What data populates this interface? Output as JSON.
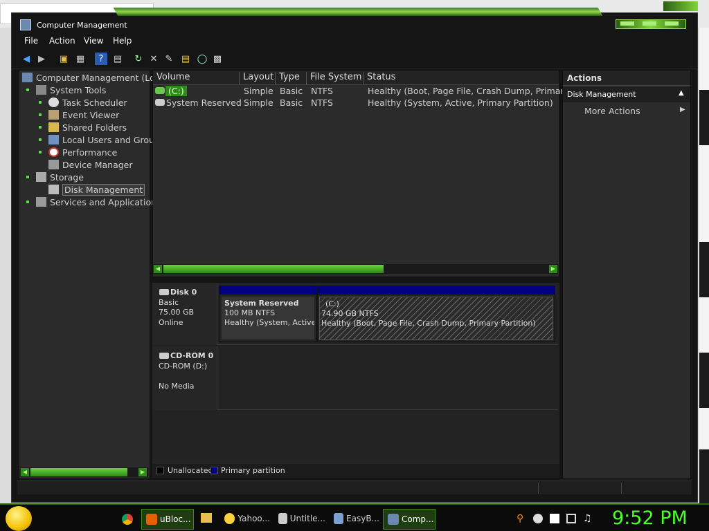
{
  "window": {
    "title": "Computer Management"
  },
  "menu": [
    "File",
    "Action",
    "View",
    "Help"
  ],
  "tree": {
    "root": "Computer Management (Loc",
    "items": [
      {
        "label": "System Tools"
      },
      {
        "label": "Task Scheduler"
      },
      {
        "label": "Event Viewer"
      },
      {
        "label": "Shared Folders"
      },
      {
        "label": "Local Users and Grou"
      },
      {
        "label": "Performance"
      },
      {
        "label": "Device Manager"
      },
      {
        "label": "Storage"
      },
      {
        "label": "Disk Management"
      },
      {
        "label": "Services and Application"
      }
    ]
  },
  "volumes": {
    "columns": [
      "Volume",
      "Layout",
      "Type",
      "File System",
      "Status"
    ],
    "rows": [
      {
        "volume": "(C:)",
        "layout": "Simple",
        "type": "Basic",
        "fs": "NTFS",
        "status": "Healthy (Boot, Page File, Crash Dump, Primary"
      },
      {
        "volume": "System Reserved",
        "layout": "Simple",
        "type": "Basic",
        "fs": "NTFS",
        "status": "Healthy (System, Active, Primary Partition)"
      }
    ]
  },
  "disks": [
    {
      "name": "Disk 0",
      "type": "Basic",
      "size": "75.00 GB",
      "state": "Online",
      "partitions": [
        {
          "name": "System Reserved",
          "size": "100 MB NTFS",
          "status": "Healthy (System, Active, P"
        },
        {
          "name": "(C:)",
          "size": "74.90 GB NTFS",
          "status": "Healthy (Boot, Page File, Crash Dump, Primary Partition)"
        }
      ]
    },
    {
      "name": "CD-ROM 0",
      "type": "CD-ROM (D:)",
      "state": "No Media"
    }
  ],
  "legend": {
    "unallocated": "Unallocated",
    "primary": "Primary partition"
  },
  "actions": {
    "title": "Actions",
    "section": "Disk Management",
    "more": "More Actions"
  },
  "taskbar": {
    "tasks": [
      {
        "label": "uBloc..."
      },
      {
        "label": "Yahoo..."
      },
      {
        "label": "Untitle..."
      },
      {
        "label": "EasyB..."
      },
      {
        "label": "Comp..."
      }
    ],
    "clock": "9:52 PM"
  },
  "colors": {
    "accent": "#5fe24a",
    "primary_partition": "#000080",
    "unallocated": "#000000",
    "window_bg": "#151515",
    "pane_bg": "#2b2b2b"
  }
}
